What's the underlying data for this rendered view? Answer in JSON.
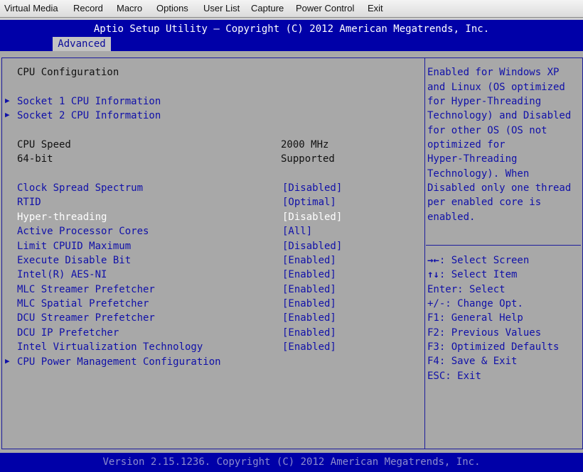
{
  "menu": [
    "Virtual Media",
    "Record",
    "Macro",
    "Options",
    "User List",
    "Capture",
    "Power Control",
    "Exit"
  ],
  "header": {
    "title": "Aptio Setup Utility – Copyright (C) 2012 American Megatrends, Inc.",
    "tab": "Advanced"
  },
  "page_title": "CPU Configuration",
  "submenus": [
    "Socket 1 CPU Information",
    "Socket 2 CPU Information"
  ],
  "info": [
    {
      "label": "CPU Speed",
      "value": "2000 MHz"
    },
    {
      "label": "64-bit",
      "value": "Supported"
    }
  ],
  "options": [
    {
      "label": "Clock Spread Spectrum",
      "value": "[Disabled]"
    },
    {
      "label": "RTID",
      "value": "[Optimal]"
    },
    {
      "label": "Hyper-threading",
      "value": "[Disabled]"
    },
    {
      "label": "Active Processor Cores",
      "value": "[All]"
    },
    {
      "label": "Limit CPUID Maximum",
      "value": "[Disabled]"
    },
    {
      "label": "Execute Disable Bit",
      "value": "[Enabled]"
    },
    {
      "label": "Intel(R) AES-NI",
      "value": "[Enabled]"
    },
    {
      "label": "MLC Streamer Prefetcher",
      "value": "[Enabled]"
    },
    {
      "label": "MLC Spatial Prefetcher",
      "value": "[Enabled]"
    },
    {
      "label": "DCU Streamer Prefetcher",
      "value": "[Enabled]"
    },
    {
      "label": "DCU IP Prefetcher",
      "value": "[Enabled]"
    },
    {
      "label": "Intel Virtualization Technology",
      "value": "[Enabled]"
    }
  ],
  "bottom_submenu": "CPU Power Management Configuration",
  "help_text": [
    "Enabled for Windows XP",
    "and Linux (OS optimized",
    "for Hyper-Threading",
    "Technology) and Disabled",
    "for other OS (OS not",
    "optimized for",
    "Hyper-Threading",
    "Technology). When",
    "Disabled only one thread",
    "per enabled core is",
    "enabled."
  ],
  "keys": [
    {
      "key": "→←",
      "action": ": Select Screen"
    },
    {
      "key": "↑↓",
      "action": ": Select Item"
    },
    {
      "key": "Enter",
      "action": ": Select"
    },
    {
      "key": "+/-",
      "action": ": Change Opt."
    },
    {
      "key": "F1",
      "action": ": General Help"
    },
    {
      "key": "F2",
      "action": ": Previous Values"
    },
    {
      "key": "F3",
      "action": ": Optimized Defaults"
    },
    {
      "key": "F4",
      "action": ": Save & Exit"
    },
    {
      "key": "ESC",
      "action": ": Exit"
    }
  ],
  "footer": "Version 2.15.1236. Copyright (C) 2012 American Megatrends, Inc.",
  "colors": {
    "header_bg": "#0000a8",
    "body_bg": "#a8a8a8",
    "option_text": "#1010a8",
    "selected_text": "#ffffff"
  }
}
